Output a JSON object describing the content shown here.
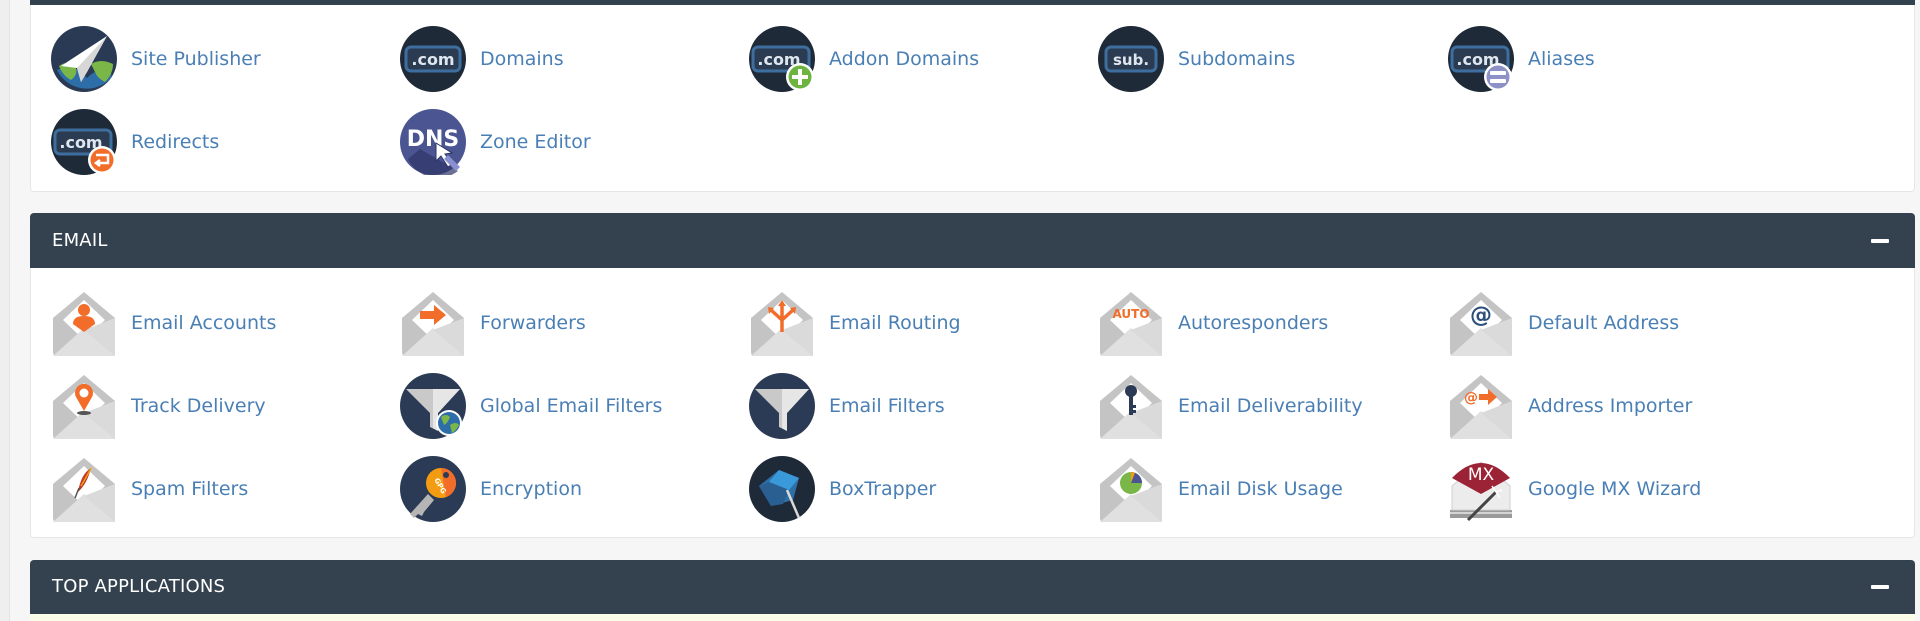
{
  "colors": {
    "header_bg": "#34424f",
    "link": "#4a7fb5",
    "accent_orange": "#f26c2a",
    "icon_dark": "#1f2a38"
  },
  "domains_section": {
    "items": [
      {
        "label": "Site Publisher",
        "icon": "site-publisher-icon"
      },
      {
        "label": "Domains",
        "icon": "domains-icon"
      },
      {
        "label": "Addon Domains",
        "icon": "addon-domains-icon"
      },
      {
        "label": "Subdomains",
        "icon": "subdomains-icon"
      },
      {
        "label": "Aliases",
        "icon": "aliases-icon"
      },
      {
        "label": "Redirects",
        "icon": "redirects-icon"
      },
      {
        "label": "Zone Editor",
        "icon": "zone-editor-icon"
      }
    ],
    "icon_text": {
      "com": ".com",
      "sub": "sub.",
      "dns": "DNS"
    }
  },
  "email_section": {
    "title": "EMAIL",
    "collapse_icon": "minus-icon",
    "items": [
      {
        "label": "Email Accounts",
        "icon": "email-accounts-icon"
      },
      {
        "label": "Forwarders",
        "icon": "forwarders-icon"
      },
      {
        "label": "Email Routing",
        "icon": "email-routing-icon"
      },
      {
        "label": "Autoresponders",
        "icon": "autoresponders-icon"
      },
      {
        "label": "Default Address",
        "icon": "default-address-icon"
      },
      {
        "label": "Track Delivery",
        "icon": "track-delivery-icon"
      },
      {
        "label": "Global Email Filters",
        "icon": "global-email-filters-icon"
      },
      {
        "label": "Email Filters",
        "icon": "email-filters-icon"
      },
      {
        "label": "Email Deliverability",
        "icon": "email-deliverability-icon"
      },
      {
        "label": "Address Importer",
        "icon": "address-importer-icon"
      },
      {
        "label": "Spam Filters",
        "icon": "spam-filters-icon"
      },
      {
        "label": "Encryption",
        "icon": "encryption-icon"
      },
      {
        "label": "BoxTrapper",
        "icon": "boxtrapper-icon"
      },
      {
        "label": "Email Disk Usage",
        "icon": "email-disk-usage-icon"
      },
      {
        "label": "Google MX Wizard",
        "icon": "google-mx-wizard-icon"
      }
    ],
    "icon_text": {
      "auto": "AUTO",
      "at": "@",
      "mx": "MX",
      "gpg": "GPG"
    }
  },
  "top_applications_section": {
    "title": "TOP APPLICATIONS",
    "collapse_icon": "minus-icon"
  }
}
